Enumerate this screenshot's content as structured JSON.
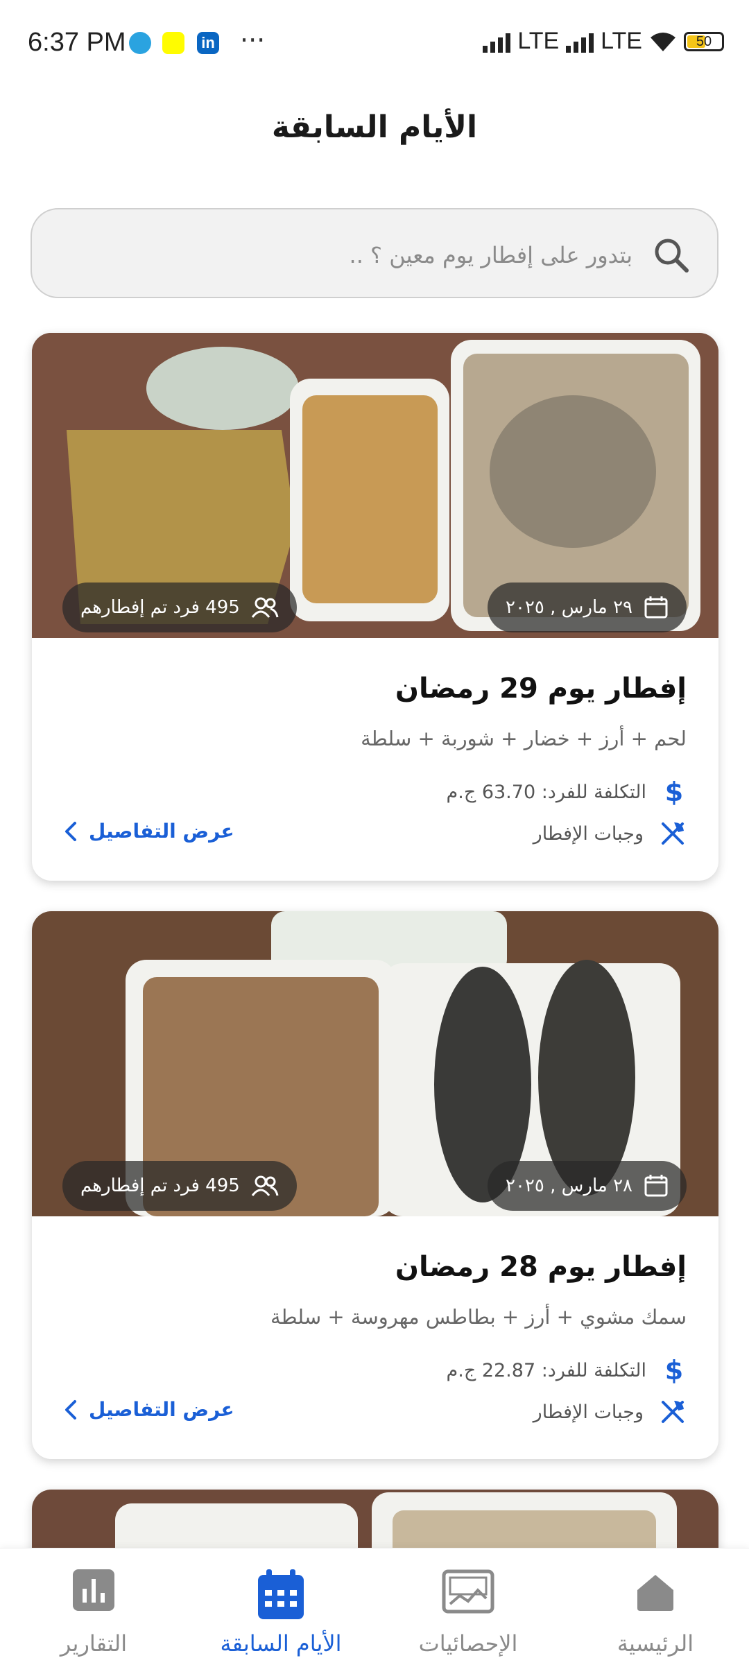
{
  "status_bar": {
    "time": "6:37 PM",
    "dots": "···",
    "network1": "LTE",
    "network2": "LTE",
    "battery": "50"
  },
  "header": {
    "title": "الأيام السابقة"
  },
  "search": {
    "placeholder": "بتدور على إفطار يوم معين ؟ .."
  },
  "cards": [
    {
      "date": "٢٩ مارس , ٢٠٢٥",
      "count": "495 فرد تم إفطارهم",
      "title": "إفطار يوم 29 رمضان",
      "description": "لحم + أرز + خضار + شوربة + سلطة",
      "cost": "التكلفة للفرد: 63.70 ج.م",
      "meals_label": "وجبات الإفطار",
      "details_label": "عرض التفاصيل"
    },
    {
      "date": "٢٨ مارس , ٢٠٢٥",
      "count": "495 فرد تم إفطارهم",
      "title": "إفطار يوم 28 رمضان",
      "description": "سمك مشوي + أرز + بطاطس مهروسة + سلطة",
      "cost": "التكلفة للفرد: 22.87 ج.م",
      "meals_label": "وجبات الإفطار",
      "details_label": "عرض التفاصيل"
    }
  ],
  "bottom_nav": [
    {
      "label": "الرئيسية",
      "icon": "home-icon"
    },
    {
      "label": "الإحصائيات",
      "icon": "chart-image-icon"
    },
    {
      "label": "الأيام السابقة",
      "icon": "calendar-icon",
      "active": true
    },
    {
      "label": "التقارير",
      "icon": "bar-chart-icon"
    }
  ],
  "colors": {
    "accent": "#1a5fd6",
    "muted": "#8a8a8a"
  }
}
